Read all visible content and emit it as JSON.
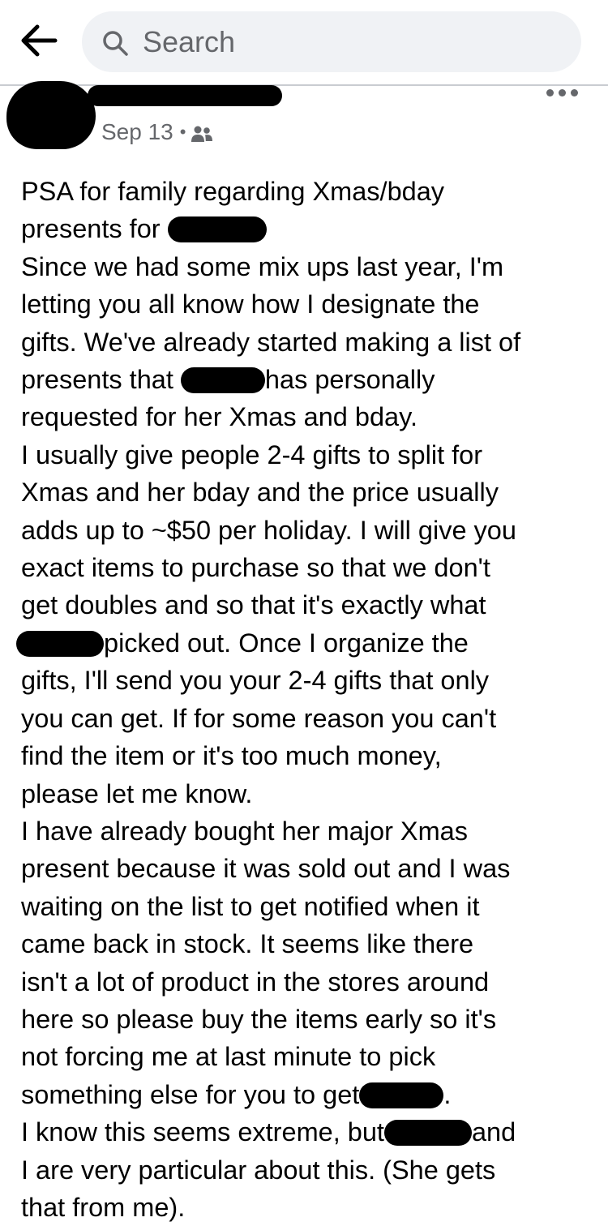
{
  "search": {
    "placeholder": "Search"
  },
  "post": {
    "date": "Sep 13",
    "separator": "•",
    "audience_icon": "friends-icon",
    "lines": [
      "PSA for family regarding Xmas/bday",
      "presents for",
      "Since we had some mix ups last year, I'm",
      "letting you all know how I designate the",
      "gifts. We've already started making a list of",
      "presents that",
      "has personally",
      "requested for her Xmas and bday.",
      "I usually give people 2-4 gifts to split for",
      "Xmas and her bday and the price usually",
      "adds up to ~$50 per holiday. I will give you",
      "exact items to purchase so that we don't",
      "get doubles and so that it's exactly what",
      "picked out.  Once I organize the",
      "gifts, I'll send you your 2-4 gifts that only",
      "you can get. If for some reason you can't",
      "find the item or it's too much money,",
      "please let me know.",
      "I have already bought her major Xmas",
      "present because it was sold out and I was",
      "waiting on the list to get notified when it",
      "came back in stock. It seems like there",
      "isn't a lot of product in the stores around",
      "here so please buy the items early so it's",
      "not forcing me at last minute to pick",
      "something else for you to get",
      ".",
      "I know this seems extreme, but",
      "and",
      "I are very particular about this. (She gets",
      "that from me)."
    ]
  },
  "colors": {
    "search_bg": "#f0f2f5",
    "secondary_text": "#65676b",
    "redaction": "#000000"
  }
}
